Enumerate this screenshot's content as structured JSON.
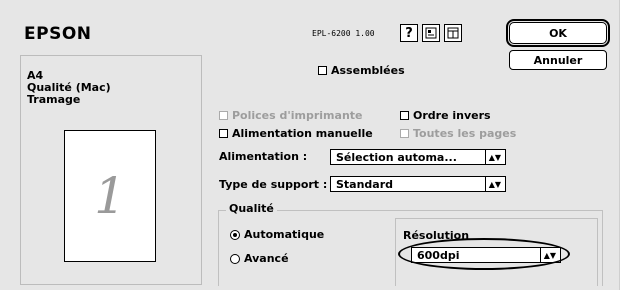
{
  "header": {
    "brand": "EPSON",
    "model": "EPL-6200  1.00",
    "help_icon": "?",
    "ok_label": "OK",
    "cancel_label": "Annuler"
  },
  "preview": {
    "lines": [
      "A4",
      "Qualité (Mac)",
      "Tramage"
    ],
    "page_number": "1"
  },
  "options": {
    "collate_label": "Assemblées",
    "printer_fonts_label": "Polices d'imprimante",
    "reverse_order_label": "Ordre invers",
    "manual_feed_label": "Alimentation manuelle",
    "all_pages_label": "Toutes les pages"
  },
  "paper_source": {
    "label": "Alimentation :",
    "value": "Sélection automa..."
  },
  "media_type": {
    "label": "Type de support :",
    "value": "Standard"
  },
  "quality": {
    "title": "Qualité",
    "auto_label": "Automatique",
    "advanced_label": "Avancé",
    "resolution_label": "Résolution",
    "resolution_value": "600dpi"
  },
  "icons": [
    "help-icon",
    "layout-icon",
    "page-icon",
    "updown-arrow-icon"
  ],
  "colors": {
    "background": "#e6e6e6",
    "accent": "#000000"
  }
}
